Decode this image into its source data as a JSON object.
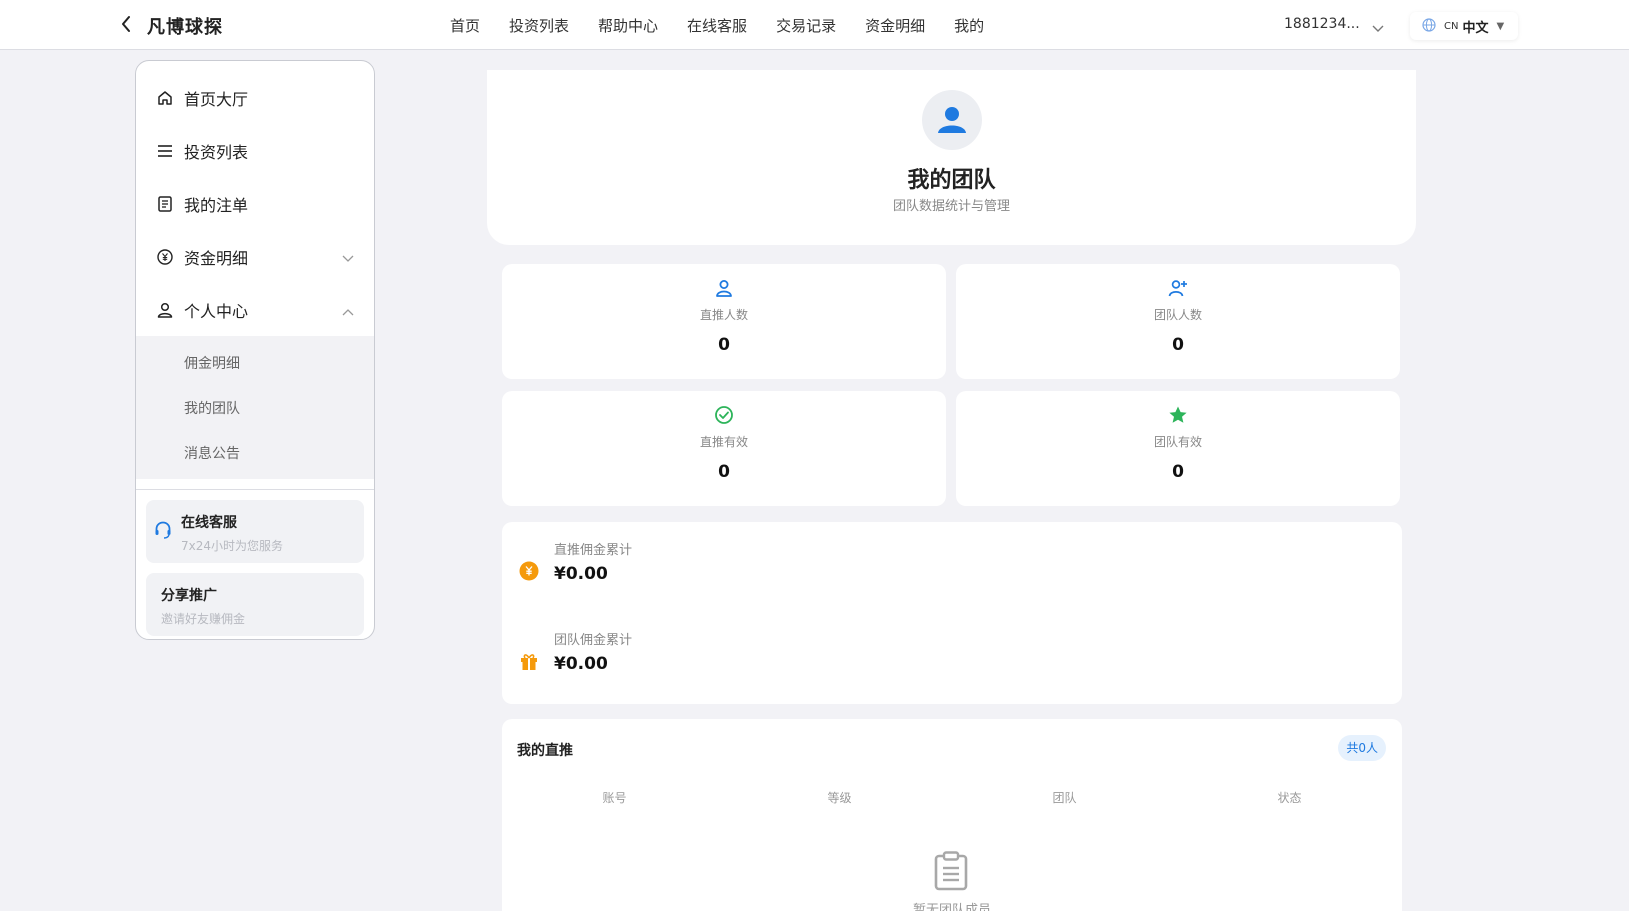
{
  "header": {
    "brand": "凡博球探",
    "nav": [
      "首页",
      "投资列表",
      "帮助中心",
      "在线客服",
      "交易记录",
      "资金明细",
      "我的"
    ],
    "user": "1881234...",
    "lang_code": "CN",
    "lang_label": "中文"
  },
  "sidebar": {
    "items": [
      {
        "label": "首页大厅",
        "icon": "home-icon"
      },
      {
        "label": "投资列表",
        "icon": "list-icon"
      },
      {
        "label": "我的注单",
        "icon": "document-icon"
      },
      {
        "label": "资金明细",
        "icon": "yuan-coin-icon"
      },
      {
        "label": "个人中心",
        "icon": "user-icon"
      }
    ],
    "sub_items": [
      "佣金明细",
      "我的团队",
      "消息公告"
    ],
    "service": {
      "title": "在线客服",
      "subtitle": "7x24小时为您服务"
    },
    "share": {
      "title": "分享推广",
      "subtitle": "邀请好友赚佣金"
    }
  },
  "hero": {
    "title": "我的团队",
    "subtitle": "团队数据统计与管理"
  },
  "stats": [
    {
      "label": "直推人数",
      "value": "0",
      "color": "#1f7ae0"
    },
    {
      "label": "团队人数",
      "value": "0",
      "color": "#1f7ae0"
    },
    {
      "label": "直推有效",
      "value": "0",
      "color": "#2db45a"
    },
    {
      "label": "团队有效",
      "value": "0",
      "color": "#2db45a"
    }
  ],
  "commissions": [
    {
      "label": "直推佣金累计",
      "value": "¥0.00"
    },
    {
      "label": "团队佣金累计",
      "value": "¥0.00"
    }
  ],
  "direct": {
    "title": "我的直推",
    "badge": "共0人",
    "columns": [
      "账号",
      "等级",
      "团队",
      "状态"
    ],
    "empty": "暂无团队成员"
  },
  "colors": {
    "accent": "#1f7ae0",
    "green": "#2db45a",
    "orange": "#f59a0c"
  }
}
